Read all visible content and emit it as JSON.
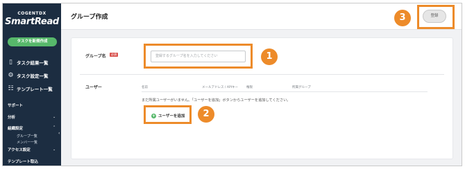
{
  "sidebar": {
    "brand_top": "COGENTDX",
    "brand": "SmartRead",
    "new_task_label": "タスクを新規作成",
    "nav": [
      {
        "label": "タスク結果一覧",
        "icon": "document-icon"
      },
      {
        "label": "タスク設定一覧",
        "icon": "gear-doc-icon"
      },
      {
        "label": "テンプレート一覧",
        "icon": "template-icon"
      }
    ],
    "support_label": "サポート",
    "analysis_label": "分析",
    "admin_label": "組織設定",
    "group_list_label": "グループ一覧",
    "member_list_label": "メンバー一覧",
    "access_label": "アクセス設定",
    "template_import_label": "テンプレート取込"
  },
  "header": {
    "title": "グループ作成",
    "register_label": "登録"
  },
  "form": {
    "group_name_label": "グループ名",
    "required_badge": "必須",
    "group_name_placeholder": "登録するグループ名を入力してください",
    "user_label": "ユーザー",
    "columns": [
      "名前",
      "メールアドレス / APIキー",
      "権限",
      "所属グループ"
    ],
    "empty_message": "まだ所属ユーザーがいません。「ユーザーを追加」ボタンからユーザーを追加してください。",
    "add_user_label": "ユーザーを追加"
  },
  "callouts": [
    "1",
    "2",
    "3"
  ],
  "colors": {
    "sidebar_bg": "#1c2d41",
    "accent_green": "#57b86b",
    "callout_orange": "#ed8b2a",
    "required_red": "#d9534f"
  }
}
